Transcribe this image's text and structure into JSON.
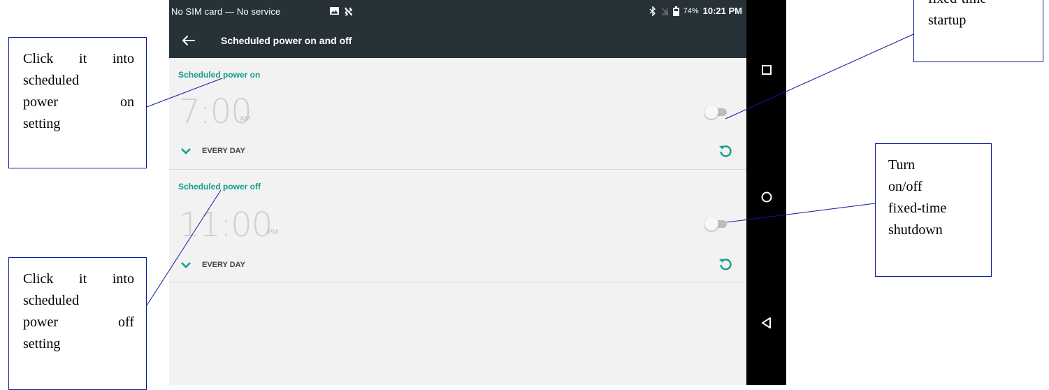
{
  "status_bar": {
    "left_text": "No SIM card — No service",
    "battery": "74%",
    "time": "10:21 PM"
  },
  "toolbar": {
    "title": "Scheduled power on and off"
  },
  "power_on": {
    "title": "Scheduled power on",
    "time": "7:00",
    "ampm": "AM",
    "repeat": "EVERY DAY",
    "enabled": false
  },
  "power_off": {
    "title": "Scheduled power off",
    "time": "11:00",
    "ampm": "PM",
    "repeat": "EVERY DAY",
    "enabled": false
  },
  "callouts": {
    "power_on_setting": {
      "w1": "Click",
      "w2": "it",
      "w3": "into",
      "w4": "scheduled",
      "w5": "power",
      "w6": "on",
      "w7": "setting"
    },
    "power_off_setting": {
      "w1": "Click",
      "w2": "it",
      "w3": "into",
      "w4": "scheduled",
      "w5": "power",
      "w6": "off",
      "w7": "setting"
    },
    "startup": {
      "line1": "fixed-time",
      "line2": "startup"
    },
    "shutdown": {
      "line1": "Turn",
      "line2": "on/off",
      "line3": "fixed-time",
      "line4": "shutdown"
    }
  },
  "colors": {
    "accent": "#139e8a",
    "toolbar": "#263238",
    "callout_border": "#0a1a9e"
  },
  "icons": [
    "image-icon",
    "n-notification-icon",
    "bluetooth-icon",
    "no-signal-icon",
    "battery-icon",
    "back-arrow-icon",
    "chevron-down-icon",
    "reset-icon",
    "square-recents-icon",
    "circle-home-icon",
    "triangle-back-icon"
  ]
}
